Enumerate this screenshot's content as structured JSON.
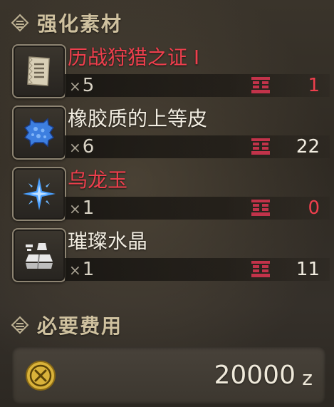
{
  "upgrade_materials": {
    "header": "强化素材",
    "items": [
      {
        "name": "历战狩猎之证 I",
        "name_color": "#ee3f4d",
        "required": "×5",
        "owned": "1",
        "owned_color": "#ee3f4d",
        "icon": "ticket-scroll-icon"
      },
      {
        "name": "橡胶质的上等皮",
        "name_color": "#f1ece0",
        "required": "×6",
        "owned": "22",
        "owned_color": "#f1ece0",
        "icon": "blue-hide-icon"
      },
      {
        "name": "乌龙玉",
        "name_color": "#ee3f4d",
        "required": "×1",
        "owned": "0",
        "owned_color": "#ee3f4d",
        "icon": "blue-jewel-icon"
      },
      {
        "name": "璀璨水晶",
        "name_color": "#f1ece0",
        "required": "×1",
        "owned": "11",
        "owned_color": "#f1ece0",
        "icon": "white-ore-icon"
      }
    ]
  },
  "cost": {
    "header": "必要费用",
    "amount": "20000",
    "unit": "z",
    "icon": "zenny-coin-icon"
  },
  "colors": {
    "accent_header": "#cfc19f",
    "insufficient": "#ee3f4d",
    "stock_icon": "#c2334a"
  }
}
